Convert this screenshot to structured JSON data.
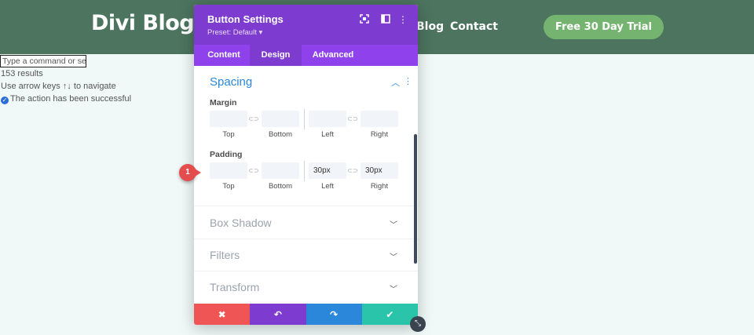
{
  "site": {
    "logo": "Divi Blog",
    "nav": [
      "Blog",
      "Contact"
    ],
    "cta": "Free 30 Day Trial",
    "colors": {
      "header_bg": "#4c745f",
      "cta_bg": "#75b470"
    }
  },
  "command_palette": {
    "placeholder": "Type a command or search",
    "results": "153 results",
    "hint": "Use arrow keys ↑↓ to navigate",
    "status": "The action has been successful"
  },
  "modal": {
    "title": "Button Settings",
    "preset": "Preset: Default ▾",
    "header_icons": [
      "expand-icon",
      "sidebar-toggle-icon",
      "more-options-icon"
    ],
    "tabs": [
      {
        "label": "Content",
        "active": false
      },
      {
        "label": "Design",
        "active": true
      },
      {
        "label": "Advanced",
        "active": false
      }
    ],
    "section": {
      "title": "Spacing",
      "margin": {
        "label": "Margin",
        "fields": [
          {
            "label": "Top",
            "value": ""
          },
          {
            "label": "Bottom",
            "value": ""
          },
          {
            "label": "Left",
            "value": ""
          },
          {
            "label": "Right",
            "value": ""
          }
        ]
      },
      "padding": {
        "label": "Padding",
        "fields": [
          {
            "label": "Top",
            "value": ""
          },
          {
            "label": "Bottom",
            "value": ""
          },
          {
            "label": "Left",
            "value": "30px"
          },
          {
            "label": "Right",
            "value": "30px"
          }
        ]
      }
    },
    "collapsed_sections": [
      "Box Shadow",
      "Filters",
      "Transform"
    ],
    "footer_buttons": [
      {
        "name": "cancel-button",
        "color": "#ef5555"
      },
      {
        "name": "undo-button",
        "color": "#7e3bd0"
      },
      {
        "name": "redo-button",
        "color": "#2b87da"
      },
      {
        "name": "save-button",
        "color": "#29c4a9"
      }
    ],
    "colors": {
      "header": "#7e3bd0",
      "tabs": "#8f42ec",
      "accent": "#2b87da"
    }
  },
  "step_marker": "1"
}
